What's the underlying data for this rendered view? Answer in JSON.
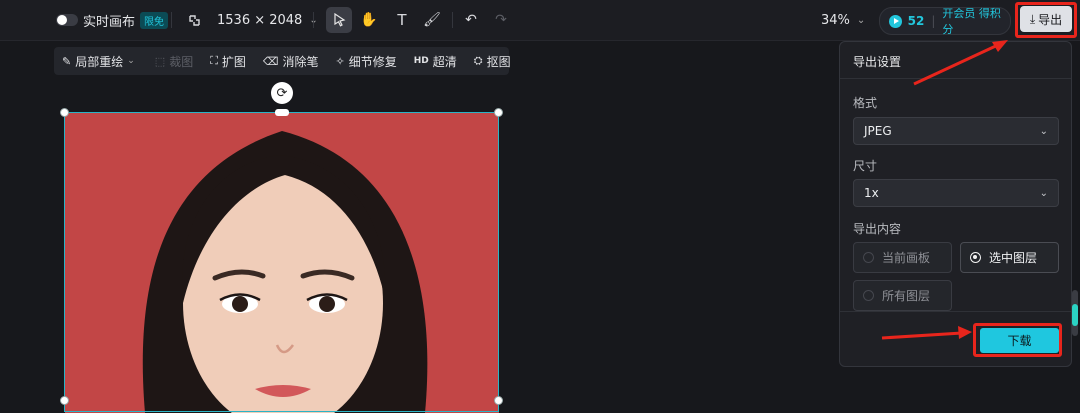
{
  "toolbar": {
    "realtime_label": "实时画布",
    "realtime_badge": "限免",
    "size_label": "1536 × 2048",
    "zoom_label": "34%",
    "points_value": "52",
    "membership_label": "开会员 得积分",
    "export_label": "导出"
  },
  "subtools": {
    "items": [
      {
        "label": "局部重绘"
      },
      {
        "label": "裁图"
      },
      {
        "label": "扩图"
      },
      {
        "label": "消除笔"
      },
      {
        "label": "细节修复"
      },
      {
        "label": "超清",
        "prefix": "HD"
      },
      {
        "label": "抠图"
      }
    ]
  },
  "export_panel": {
    "title": "导出设置",
    "format_label": "格式",
    "format_value": "JPEG",
    "size_label": "尺寸",
    "size_value": "1x",
    "content_label": "导出内容",
    "options": [
      "当前画板",
      "选中图层",
      "所有图层"
    ],
    "selected_option": "选中图层",
    "download_label": "下载"
  },
  "colors": {
    "accent": "#1fc7df",
    "highlight": "#e8251c",
    "background": "#17181c",
    "photo_background": "#c24646"
  }
}
